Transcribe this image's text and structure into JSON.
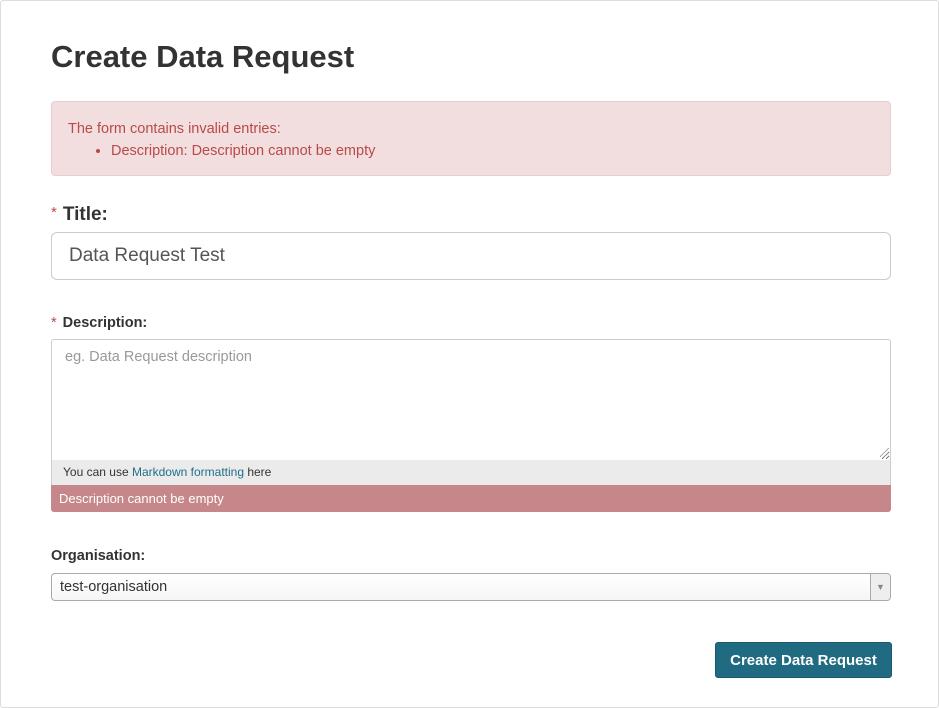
{
  "page": {
    "title": "Create Data Request"
  },
  "alert": {
    "heading": "The form contains invalid entries:",
    "errors": [
      "Description: Description cannot be empty"
    ]
  },
  "form": {
    "required_marker": "*",
    "title_field": {
      "label": "Title:",
      "value": "Data Request Test"
    },
    "description_field": {
      "label": "Description:",
      "value": "",
      "placeholder": "eg. Data Request description",
      "hint_prefix": "You can use ",
      "hint_link": "Markdown formatting",
      "hint_suffix": " here",
      "error": "Description cannot be empty"
    },
    "organisation_field": {
      "label": "Organisation:",
      "selected": "test-organisation",
      "arrow": "▼"
    },
    "submit_label": "Create Data Request"
  },
  "colors": {
    "alert_bg": "#f2dede",
    "alert_text": "#b94a48",
    "error_bar": "#c6878a",
    "primary_button": "#206b82",
    "link": "#1f6f8b"
  }
}
